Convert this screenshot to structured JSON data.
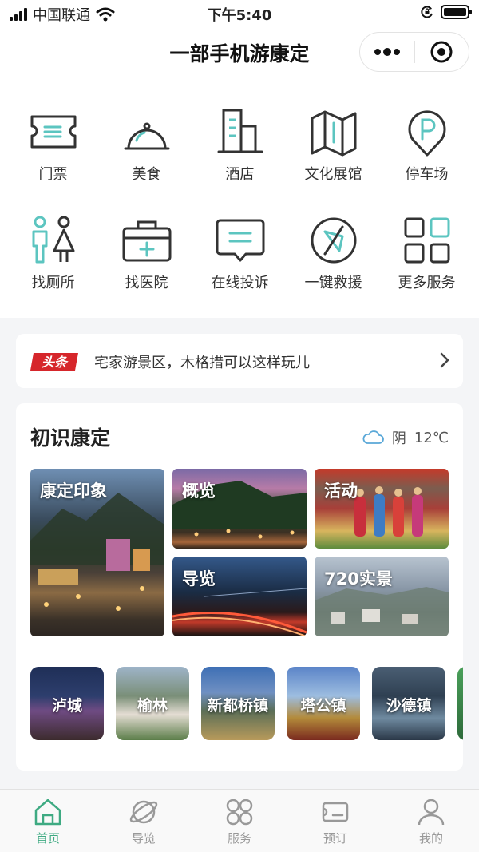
{
  "status_bar": {
    "carrier": "中国联通",
    "time": "下午5:40",
    "battery_level": 1.0
  },
  "nav": {
    "title": "一部手机游康定"
  },
  "services": [
    {
      "label": "门票",
      "icon": "ticket-icon"
    },
    {
      "label": "美食",
      "icon": "food-cloche-icon"
    },
    {
      "label": "酒店",
      "icon": "hotel-building-icon"
    },
    {
      "label": "文化展馆",
      "icon": "map-icon"
    },
    {
      "label": "停车场",
      "icon": "parking-icon"
    },
    {
      "label": "找厕所",
      "icon": "restroom-icon"
    },
    {
      "label": "找医院",
      "icon": "medical-kit-icon"
    },
    {
      "label": "在线投诉",
      "icon": "complaint-chat-icon"
    },
    {
      "label": "一键救援",
      "icon": "compass-rescue-icon"
    },
    {
      "label": "更多服务",
      "icon": "more-grid-icon"
    }
  ],
  "headline": {
    "logo_text": "头条",
    "text": "宅家游景区，木格措可以这样玩儿"
  },
  "intro_card": {
    "title": "初识康定",
    "weather": {
      "condition": "阴",
      "temperature": "12℃",
      "icon": "cloud-icon"
    },
    "tiles": [
      {
        "label": "康定印象"
      },
      {
        "label": "概览"
      },
      {
        "label": "活动"
      },
      {
        "label": "导览"
      },
      {
        "label": "720实景"
      }
    ],
    "towns": [
      {
        "label": "泸城"
      },
      {
        "label": "榆林"
      },
      {
        "label": "新都桥镇"
      },
      {
        "label": "塔公镇"
      },
      {
        "label": "沙德镇"
      }
    ]
  },
  "tabbar": {
    "active_color": "#3eaa82",
    "inactive_color": "#999999",
    "tabs": [
      {
        "label": "首页",
        "icon": "home-icon",
        "active": true
      },
      {
        "label": "导览",
        "icon": "planet-icon",
        "active": false
      },
      {
        "label": "服务",
        "icon": "service-circles-icon",
        "active": false
      },
      {
        "label": "预订",
        "icon": "ticket-card-icon",
        "active": false
      },
      {
        "label": "我的",
        "icon": "user-icon",
        "active": false
      }
    ]
  },
  "colors": {
    "accent": "#3eaa82",
    "icon_teal": "#5cc5c0",
    "icon_dark": "#333333",
    "headline_logo_red": "#d6262b"
  }
}
